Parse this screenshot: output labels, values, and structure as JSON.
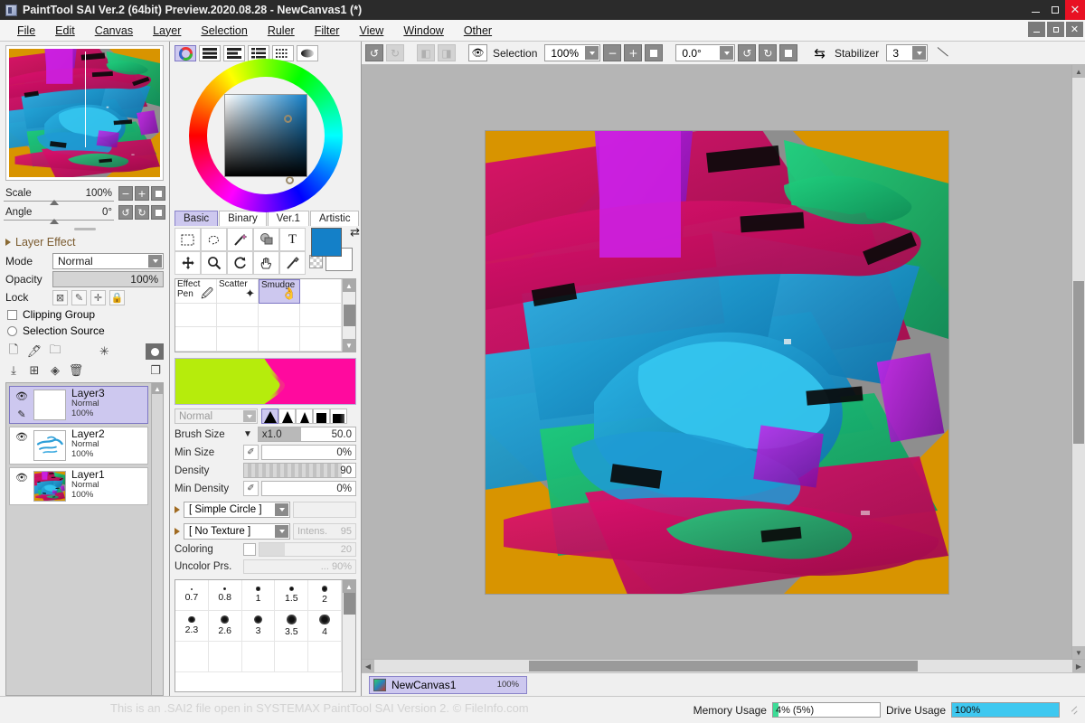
{
  "window": {
    "title": "PaintTool SAI Ver.2 (64bit) Preview.2020.08.28 - NewCanvas1 (*)",
    "icon": "app-icon",
    "controls": {
      "minimize": "–",
      "maximize": "□",
      "close": "✕"
    },
    "mdi_controls": {
      "minimize": "–",
      "restore": "❐",
      "close": "✕"
    }
  },
  "menubar": {
    "items": [
      {
        "label": "File"
      },
      {
        "label": "Edit"
      },
      {
        "label": "Canvas"
      },
      {
        "label": "Layer"
      },
      {
        "label": "Selection"
      },
      {
        "label": "Ruler"
      },
      {
        "label": "Filter"
      },
      {
        "label": "View"
      },
      {
        "label": "Window"
      },
      {
        "label": "Other"
      }
    ]
  },
  "navigator": {
    "scale": {
      "label": "Scale",
      "value": "100%"
    },
    "angle": {
      "label": "Angle",
      "value": "0°"
    },
    "scale_buttons": [
      "minus-icon",
      "plus-icon",
      "reset-icon"
    ],
    "angle_buttons": [
      "rotate-ccw-icon",
      "rotate-cw-icon",
      "reset-icon"
    ]
  },
  "layer_panel": {
    "layer_effect_label": "Layer Effect",
    "mode_label": "Mode",
    "mode_value": "Normal",
    "opacity_label": "Opacity",
    "opacity_value": "100%",
    "lock_label": "Lock",
    "lock_icons": [
      "lock-pixel-icon",
      "lock-paint-icon",
      "lock-move-icon",
      "lock-all-icon"
    ],
    "clipping_group": "Clipping Group",
    "selection_source": "Selection Source",
    "toolbar_row1": [
      "new-layer-icon",
      "new-linework-layer-icon",
      "new-folder-icon",
      "layer-mask-icon",
      "clipping-indicator-icon"
    ],
    "toolbar_row2": [
      "merge-down-icon",
      "add-layer-icon",
      "merge-icon",
      "delete-layer-icon",
      "duplicate-icon"
    ],
    "layers": [
      {
        "name": "Layer3",
        "mode": "Normal",
        "opacity": "100%",
        "selected": true,
        "visible": true,
        "thumb": "blank"
      },
      {
        "name": "Layer2",
        "mode": "Normal",
        "opacity": "100%",
        "selected": false,
        "visible": true,
        "thumb": "blue-strokes"
      },
      {
        "name": "Layer1",
        "mode": "Normal",
        "opacity": "100%",
        "selected": false,
        "visible": true,
        "thumb": "artwork"
      }
    ]
  },
  "color_panel": {
    "mode_buttons": [
      {
        "name": "color-wheel-mode",
        "active": true
      },
      {
        "name": "rgb-sliders-mode",
        "active": false
      },
      {
        "name": "hsv-sliders-mode",
        "active": false
      },
      {
        "name": "color-list-mode",
        "active": false
      },
      {
        "name": "swatches-mode",
        "active": false
      },
      {
        "name": "gradient-mode",
        "active": false
      }
    ],
    "current_color": "#1480c8"
  },
  "tool_panel": {
    "tabs": [
      {
        "label": "Basic",
        "active": true
      },
      {
        "label": "Binary",
        "active": false
      },
      {
        "label": "Ver.1",
        "active": false
      },
      {
        "label": "Artistic",
        "active": false
      }
    ],
    "tools_row1": [
      "rect-select-icon",
      "lasso-select-icon",
      "magic-wand-icon",
      "select-pen-icon",
      "text-icon"
    ],
    "tools_row2": [
      "move-icon",
      "zoom-icon",
      "rotate-icon",
      "hand-icon",
      "eyedropper-icon"
    ],
    "swatch_foreground": "#1480c8",
    "swatch_background": "#ffffff",
    "swap_icon": "swap-colors-icon",
    "transparent_icon": "transparency-icon"
  },
  "brush_presets": {
    "items": [
      {
        "label": "Effect Pen",
        "glyph": "effect-pen-icon",
        "selected": false
      },
      {
        "label": "Scatter",
        "glyph": "scatter-icon",
        "selected": false
      },
      {
        "label": "Smudge",
        "glyph": "smudge-icon",
        "selected": true
      }
    ],
    "scroll_up": "scroll-up-icon",
    "scroll_down": "scroll-down-icon"
  },
  "brush_preview": {
    "left_color": "#b6ec0c",
    "right_color": "#ff0a9e"
  },
  "brush_settings": {
    "blend_mode": "Normal",
    "shape_buttons": [
      "soft-round-shape",
      "round-shape",
      "narrow-shape",
      "square-shape",
      "flat-shape"
    ],
    "brush_size": {
      "label": "Brush Size",
      "multiplier": "x1.0",
      "value": "50.0"
    },
    "min_size": {
      "label": "Min Size",
      "value": "0%"
    },
    "density": {
      "label": "Density",
      "value": "90"
    },
    "min_density": {
      "label": "Min Density",
      "value": "0%"
    },
    "shape_preset": "[ Simple Circle ]",
    "texture_preset": "[ No Texture ]",
    "texture_intensity_label": "Intens.",
    "texture_intensity_value": "95",
    "coloring": {
      "label": "Coloring",
      "value": "20"
    },
    "uncolor_prs": {
      "label": "Uncolor Prs.",
      "value": "... 90%"
    }
  },
  "size_grid": {
    "values": [
      "0.7",
      "0.8",
      "1",
      "1.5",
      "2",
      "2.3",
      "2.6",
      "3",
      "3.5",
      "4",
      "",
      "",
      "",
      "",
      ""
    ]
  },
  "canvas_toolbar": {
    "undo_icon": "undo-icon",
    "redo_icon": "redo-icon",
    "extra_icons": [
      "nav-left-icon",
      "nav-right-icon"
    ],
    "selection_eye_icon": "eye-icon",
    "selection_label": "Selection",
    "zoom_value": "100%",
    "zoom_out_icon": "minus-icon",
    "zoom_in_icon": "plus-icon",
    "zoom_reset_icon": "reset-icon",
    "angle_value": "0.0°",
    "rotate_ccw_icon": "rotate-ccw-icon",
    "rotate_cw_icon": "rotate-cw-icon",
    "angle_reset_icon": "reset-icon",
    "flip_icon": "flip-horizontal-icon",
    "stabilizer_label": "Stabilizer",
    "stabilizer_value": "3",
    "line_tool_icon": "line-icon"
  },
  "canvas_tab": {
    "name": "NewCanvas1",
    "zoom": "100%",
    "icon": "canvas-thumb-icon"
  },
  "statusbar": {
    "watermark": "This is an .SAI2 file open in SYSTEMAX PaintTool SAI Version 2. © FileInfo.com",
    "memory_label": "Memory Usage",
    "memory_value": "4% (5%)",
    "memory_percent": 5,
    "memory_color": "#3ddc97",
    "drive_label": "Drive Usage",
    "drive_value": "100%",
    "drive_percent": 100,
    "drive_color": "#3ec8f0",
    "resize_grip": "resize-grip-icon"
  },
  "artwork": {
    "background": "#8e8e8e",
    "accent_orange": "#d89400",
    "palette": [
      "#c9105a",
      "#1f9bd4",
      "#17b26a",
      "#b81fd4",
      "#000000",
      "#d89400"
    ]
  }
}
